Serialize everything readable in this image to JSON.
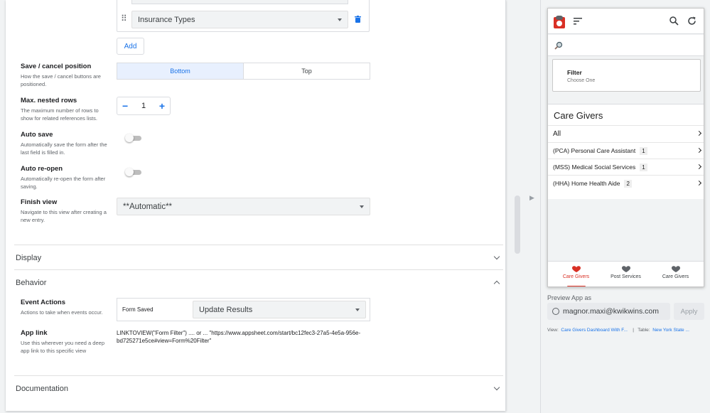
{
  "references": {
    "item_value": "Insurance Types",
    "add_label": "Add"
  },
  "settings": {
    "save_cancel": {
      "title": "Save / cancel position",
      "desc": "How the save / cancel buttons are positioned.",
      "options": [
        "Bottom",
        "Top"
      ],
      "selected": "Bottom"
    },
    "max_nested": {
      "title": "Max. nested rows",
      "desc": "The maximum number of rows to show for related references lists.",
      "value": "1"
    },
    "auto_save": {
      "title": "Auto save",
      "desc": "Automatically save the form after the last field is filled in.",
      "on": false
    },
    "auto_reopen": {
      "title": "Auto re-open",
      "desc": "Automatically re-open the form after saving.",
      "on": false
    },
    "finish_view": {
      "title": "Finish view",
      "desc": "Navigate to this view after creating a new entry.",
      "value": "**Automatic**"
    }
  },
  "sections": {
    "display": "Display",
    "behavior": "Behavior",
    "documentation": "Documentation"
  },
  "behavior": {
    "event_actions": {
      "title": "Event Actions",
      "desc": "Actions to take when events occur.",
      "event_label": "Form Saved",
      "action_value": "Update Results"
    },
    "app_link": {
      "title": "App link",
      "desc": "Use this wherever you need a deep app link to this specific view",
      "value": "LINKTOVIEW(\"Form Filter\") .... or ... \"https://www.appsheet.com/start/bc12fec3-27a5-4e5a-956e-bd725271e5ce#view=Form%20Filter\""
    }
  },
  "preview": {
    "filter_title": "Filter",
    "filter_sub": "Choose One",
    "list_title": "Care Givers",
    "rows": [
      {
        "label": "All",
        "count": ""
      },
      {
        "label": "(PCA) Personal Care Assistant",
        "count": "1"
      },
      {
        "label": "(MSS) Medical Social Services",
        "count": "1"
      },
      {
        "label": "(HHA) Home Health Aide",
        "count": "2"
      }
    ],
    "nav": [
      "Care Givers",
      "Post Services",
      "Care Givers"
    ],
    "preview_as_label": "Preview App as",
    "email": "magnor.maxi@kwikwins.com",
    "apply_label": "Apply",
    "view_label": "View:",
    "view_value": "Care Givers Dashboard With F...",
    "separator": "|",
    "table_label": "Table:",
    "table_value": "New York State ..."
  },
  "colors": {
    "accent": "#1a73e8",
    "brand_red": "#d93025"
  }
}
